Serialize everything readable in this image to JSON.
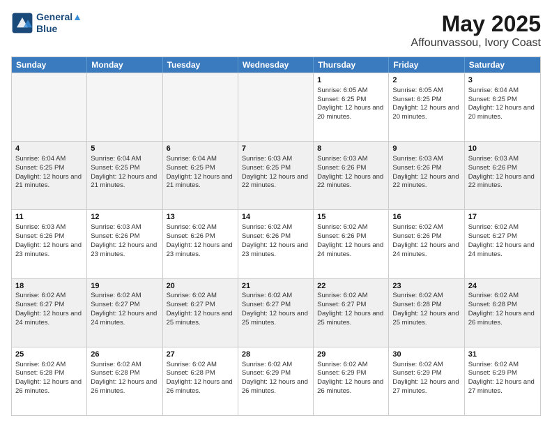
{
  "logo": {
    "line1": "General",
    "line2": "Blue"
  },
  "title": "May 2025",
  "subtitle": "Affounvassou, Ivory Coast",
  "days": [
    "Sunday",
    "Monday",
    "Tuesday",
    "Wednesday",
    "Thursday",
    "Friday",
    "Saturday"
  ],
  "rows": [
    [
      {
        "day": "",
        "content": "",
        "empty": true
      },
      {
        "day": "",
        "content": "",
        "empty": true
      },
      {
        "day": "",
        "content": "",
        "empty": true
      },
      {
        "day": "",
        "content": "",
        "empty": true
      },
      {
        "day": "1",
        "sunrise": "Sunrise: 6:05 AM",
        "sunset": "Sunset: 6:25 PM",
        "daylight": "Daylight: 12 hours and 20 minutes."
      },
      {
        "day": "2",
        "sunrise": "Sunrise: 6:05 AM",
        "sunset": "Sunset: 6:25 PM",
        "daylight": "Daylight: 12 hours and 20 minutes."
      },
      {
        "day": "3",
        "sunrise": "Sunrise: 6:04 AM",
        "sunset": "Sunset: 6:25 PM",
        "daylight": "Daylight: 12 hours and 20 minutes."
      }
    ],
    [
      {
        "day": "4",
        "sunrise": "Sunrise: 6:04 AM",
        "sunset": "Sunset: 6:25 PM",
        "daylight": "Daylight: 12 hours and 21 minutes."
      },
      {
        "day": "5",
        "sunrise": "Sunrise: 6:04 AM",
        "sunset": "Sunset: 6:25 PM",
        "daylight": "Daylight: 12 hours and 21 minutes."
      },
      {
        "day": "6",
        "sunrise": "Sunrise: 6:04 AM",
        "sunset": "Sunset: 6:25 PM",
        "daylight": "Daylight: 12 hours and 21 minutes."
      },
      {
        "day": "7",
        "sunrise": "Sunrise: 6:03 AM",
        "sunset": "Sunset: 6:25 PM",
        "daylight": "Daylight: 12 hours and 22 minutes."
      },
      {
        "day": "8",
        "sunrise": "Sunrise: 6:03 AM",
        "sunset": "Sunset: 6:26 PM",
        "daylight": "Daylight: 12 hours and 22 minutes."
      },
      {
        "day": "9",
        "sunrise": "Sunrise: 6:03 AM",
        "sunset": "Sunset: 6:26 PM",
        "daylight": "Daylight: 12 hours and 22 minutes."
      },
      {
        "day": "10",
        "sunrise": "Sunrise: 6:03 AM",
        "sunset": "Sunset: 6:26 PM",
        "daylight": "Daylight: 12 hours and 22 minutes."
      }
    ],
    [
      {
        "day": "11",
        "sunrise": "Sunrise: 6:03 AM",
        "sunset": "Sunset: 6:26 PM",
        "daylight": "Daylight: 12 hours and 23 minutes."
      },
      {
        "day": "12",
        "sunrise": "Sunrise: 6:03 AM",
        "sunset": "Sunset: 6:26 PM",
        "daylight": "Daylight: 12 hours and 23 minutes."
      },
      {
        "day": "13",
        "sunrise": "Sunrise: 6:02 AM",
        "sunset": "Sunset: 6:26 PM",
        "daylight": "Daylight: 12 hours and 23 minutes."
      },
      {
        "day": "14",
        "sunrise": "Sunrise: 6:02 AM",
        "sunset": "Sunset: 6:26 PM",
        "daylight": "Daylight: 12 hours and 23 minutes."
      },
      {
        "day": "15",
        "sunrise": "Sunrise: 6:02 AM",
        "sunset": "Sunset: 6:26 PM",
        "daylight": "Daylight: 12 hours and 24 minutes."
      },
      {
        "day": "16",
        "sunrise": "Sunrise: 6:02 AM",
        "sunset": "Sunset: 6:26 PM",
        "daylight": "Daylight: 12 hours and 24 minutes."
      },
      {
        "day": "17",
        "sunrise": "Sunrise: 6:02 AM",
        "sunset": "Sunset: 6:27 PM",
        "daylight": "Daylight: 12 hours and 24 minutes."
      }
    ],
    [
      {
        "day": "18",
        "sunrise": "Sunrise: 6:02 AM",
        "sunset": "Sunset: 6:27 PM",
        "daylight": "Daylight: 12 hours and 24 minutes."
      },
      {
        "day": "19",
        "sunrise": "Sunrise: 6:02 AM",
        "sunset": "Sunset: 6:27 PM",
        "daylight": "Daylight: 12 hours and 24 minutes."
      },
      {
        "day": "20",
        "sunrise": "Sunrise: 6:02 AM",
        "sunset": "Sunset: 6:27 PM",
        "daylight": "Daylight: 12 hours and 25 minutes."
      },
      {
        "day": "21",
        "sunrise": "Sunrise: 6:02 AM",
        "sunset": "Sunset: 6:27 PM",
        "daylight": "Daylight: 12 hours and 25 minutes."
      },
      {
        "day": "22",
        "sunrise": "Sunrise: 6:02 AM",
        "sunset": "Sunset: 6:27 PM",
        "daylight": "Daylight: 12 hours and 25 minutes."
      },
      {
        "day": "23",
        "sunrise": "Sunrise: 6:02 AM",
        "sunset": "Sunset: 6:28 PM",
        "daylight": "Daylight: 12 hours and 25 minutes."
      },
      {
        "day": "24",
        "sunrise": "Sunrise: 6:02 AM",
        "sunset": "Sunset: 6:28 PM",
        "daylight": "Daylight: 12 hours and 26 minutes."
      }
    ],
    [
      {
        "day": "25",
        "sunrise": "Sunrise: 6:02 AM",
        "sunset": "Sunset: 6:28 PM",
        "daylight": "Daylight: 12 hours and 26 minutes."
      },
      {
        "day": "26",
        "sunrise": "Sunrise: 6:02 AM",
        "sunset": "Sunset: 6:28 PM",
        "daylight": "Daylight: 12 hours and 26 minutes."
      },
      {
        "day": "27",
        "sunrise": "Sunrise: 6:02 AM",
        "sunset": "Sunset: 6:28 PM",
        "daylight": "Daylight: 12 hours and 26 minutes."
      },
      {
        "day": "28",
        "sunrise": "Sunrise: 6:02 AM",
        "sunset": "Sunset: 6:29 PM",
        "daylight": "Daylight: 12 hours and 26 minutes."
      },
      {
        "day": "29",
        "sunrise": "Sunrise: 6:02 AM",
        "sunset": "Sunset: 6:29 PM",
        "daylight": "Daylight: 12 hours and 26 minutes."
      },
      {
        "day": "30",
        "sunrise": "Sunrise: 6:02 AM",
        "sunset": "Sunset: 6:29 PM",
        "daylight": "Daylight: 12 hours and 27 minutes."
      },
      {
        "day": "31",
        "sunrise": "Sunrise: 6:02 AM",
        "sunset": "Sunset: 6:29 PM",
        "daylight": "Daylight: 12 hours and 27 minutes."
      }
    ]
  ]
}
